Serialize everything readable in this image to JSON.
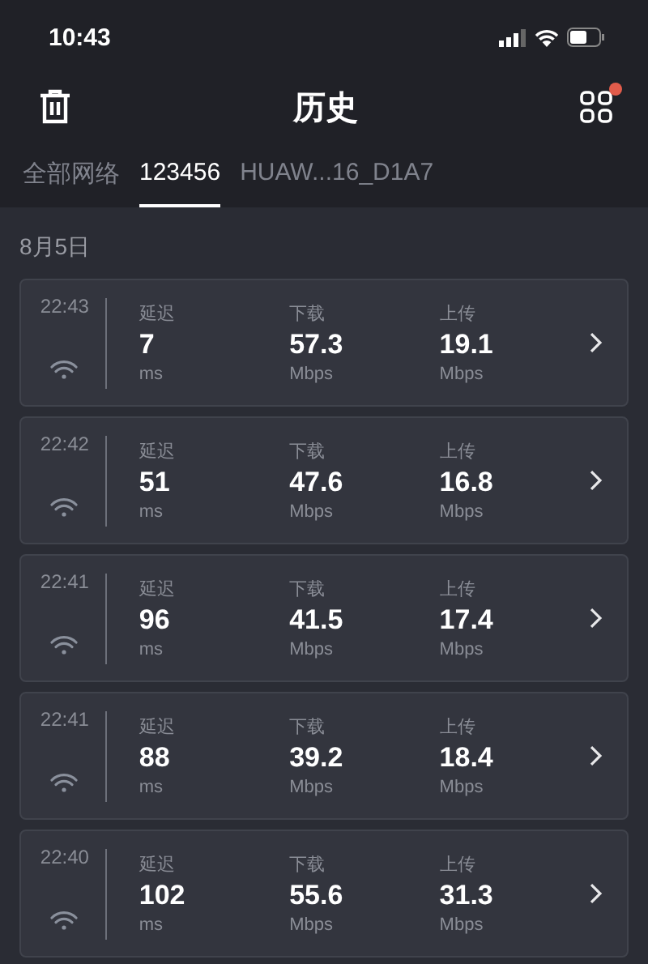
{
  "status_bar": {
    "time": "10:43"
  },
  "header": {
    "title": "历史",
    "notification_dot": true
  },
  "tabs": [
    {
      "label": "全部网络",
      "selected": false
    },
    {
      "label": "123456",
      "selected": true
    },
    {
      "label": "HUAW...16_D1A7",
      "selected": false
    }
  ],
  "date": "8月5日",
  "records": [
    {
      "time": "22:43",
      "metrics": [
        {
          "label": "延迟",
          "value": "7",
          "unit": "ms"
        },
        {
          "label": "下载",
          "value": "57.3",
          "unit": "Mbps"
        },
        {
          "label": "上传",
          "value": "19.1",
          "unit": "Mbps"
        }
      ]
    },
    {
      "time": "22:42",
      "metrics": [
        {
          "label": "延迟",
          "value": "51",
          "unit": "ms"
        },
        {
          "label": "下载",
          "value": "47.6",
          "unit": "Mbps"
        },
        {
          "label": "上传",
          "value": "16.8",
          "unit": "Mbps"
        }
      ]
    },
    {
      "time": "22:41",
      "metrics": [
        {
          "label": "延迟",
          "value": "96",
          "unit": "ms"
        },
        {
          "label": "下载",
          "value": "41.5",
          "unit": "Mbps"
        },
        {
          "label": "上传",
          "value": "17.4",
          "unit": "Mbps"
        }
      ]
    },
    {
      "time": "22:41",
      "metrics": [
        {
          "label": "延迟",
          "value": "88",
          "unit": "ms"
        },
        {
          "label": "下载",
          "value": "39.2",
          "unit": "Mbps"
        },
        {
          "label": "上传",
          "value": "18.4",
          "unit": "Mbps"
        }
      ]
    },
    {
      "time": "22:40",
      "metrics": [
        {
          "label": "延迟",
          "value": "102",
          "unit": "ms"
        },
        {
          "label": "下载",
          "value": "55.6",
          "unit": "Mbps"
        },
        {
          "label": "上传",
          "value": "31.3",
          "unit": "Mbps"
        }
      ]
    }
  ]
}
